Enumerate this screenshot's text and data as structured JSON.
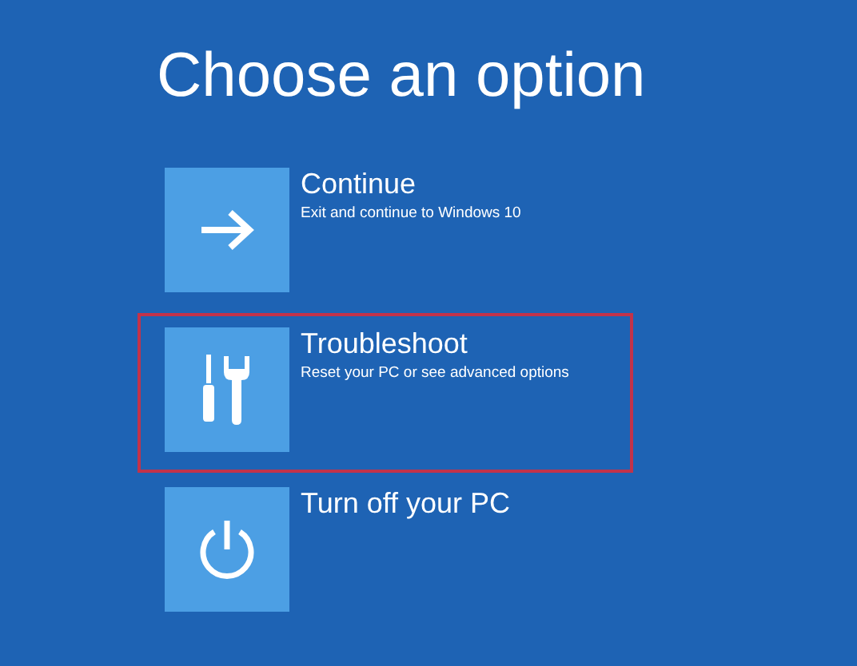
{
  "title": "Choose an option",
  "options": [
    {
      "kind": "arrow",
      "label": "Continue",
      "description": "Exit and continue to Windows 10",
      "selected": false
    },
    {
      "kind": "tools",
      "label": "Troubleshoot",
      "description": "Reset your PC or see advanced options",
      "selected": true
    },
    {
      "kind": "power",
      "label": "Turn off your PC",
      "selected": false
    }
  ]
}
